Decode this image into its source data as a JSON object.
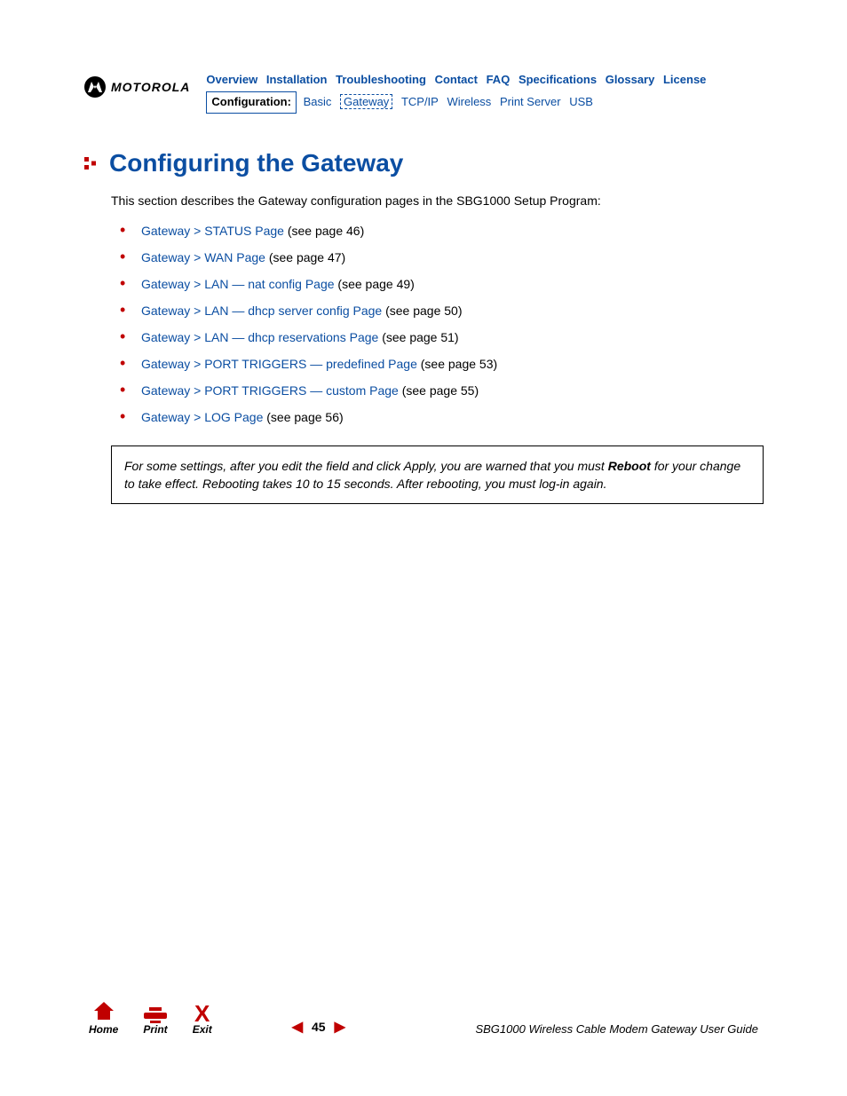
{
  "brand": "MOTOROLA",
  "top_nav": {
    "row1": [
      "Overview",
      "Installation",
      "Troubleshooting",
      "Contact",
      "FAQ",
      "Specifications",
      "Glossary",
      "License"
    ],
    "config_label": "Configuration:",
    "row2": [
      "Basic",
      "Gateway",
      "TCP/IP",
      "Wireless",
      "Print Server",
      "USB"
    ],
    "active_sub": "Gateway"
  },
  "heading": "Configuring the Gateway",
  "intro": "This section describes the Gateway configuration pages in the SBG1000 Setup Program:",
  "items": [
    {
      "link": "Gateway > STATUS Page",
      "suffix": " (see page 46)"
    },
    {
      "link": "Gateway > WAN Page",
      "suffix": " (see page 47)"
    },
    {
      "link": "Gateway > LAN — nat config Page",
      "suffix": " (see page 49)"
    },
    {
      "link": "Gateway > LAN — dhcp server config Page",
      "suffix": " (see page 50)"
    },
    {
      "link": "Gateway > LAN — dhcp reservations Page",
      "suffix": " (see page 51)"
    },
    {
      "link": "Gateway > PORT TRIGGERS — predefined Page",
      "suffix": " (see page 53)"
    },
    {
      "link": "Gateway > PORT TRIGGERS — custom Page",
      "suffix": " (see page 55)"
    },
    {
      "link": "Gateway > LOG Page",
      "suffix": " (see page 56)"
    }
  ],
  "note": {
    "pre": "For some settings, after you edit the field and click Apply, you are warned that you must ",
    "bold": "Reboot",
    "post": " for your change to take effect. Rebooting takes 10 to 15 seconds. After rebooting, you must log-in again."
  },
  "footer": {
    "home": "Home",
    "print": "Print",
    "exit": "Exit",
    "page": "45",
    "doc": "SBG1000 Wireless Cable Modem Gateway User Guide"
  }
}
